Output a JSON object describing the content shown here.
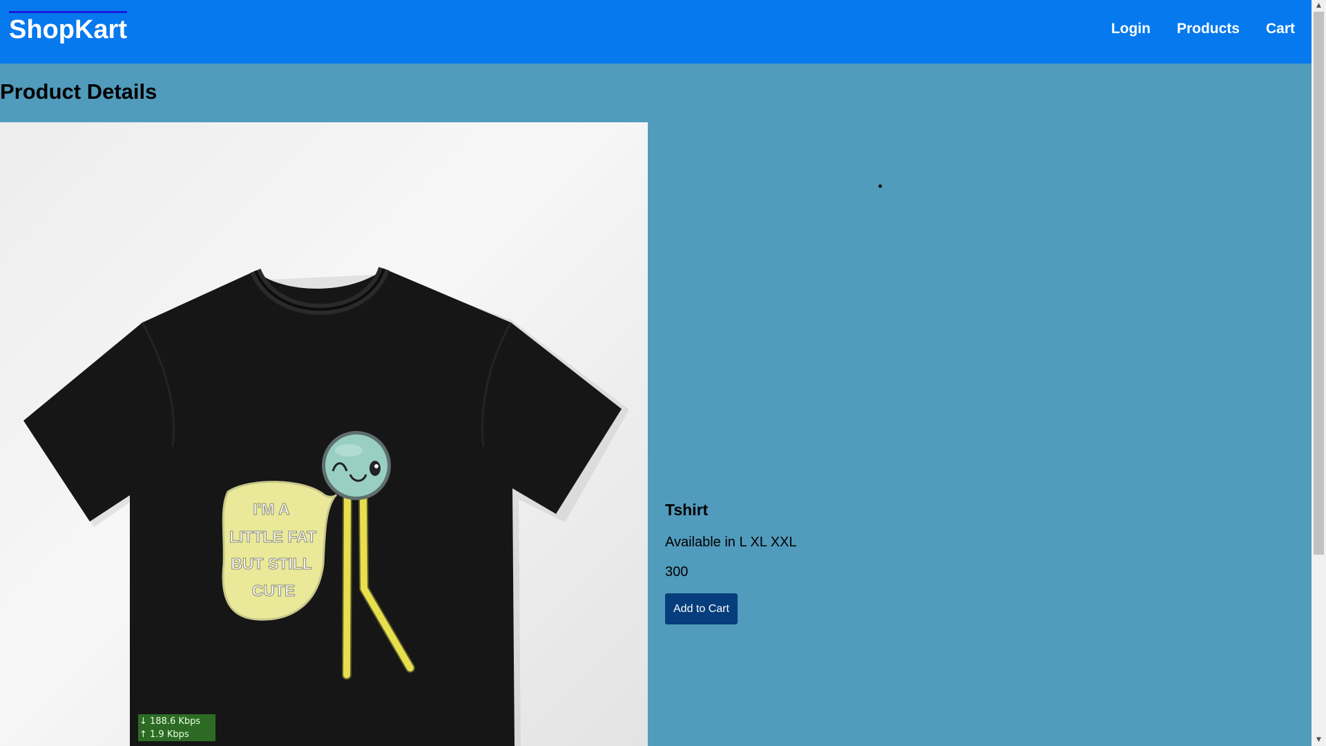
{
  "navbar": {
    "brand": "ShopKart",
    "links": [
      "Login",
      "Products",
      "Cart"
    ]
  },
  "page": {
    "title": "Product Details"
  },
  "product": {
    "image_text_lines": [
      "I'M A",
      "LITTLE FAT",
      "BUT STILL",
      "CUTE"
    ],
    "name": "Tshirt",
    "availability": "Available in L XL XXL",
    "price": "300",
    "add_to_cart_label": "Add to Cart"
  },
  "overlay": {
    "download_speed": "↓ 188.6 Kbps",
    "upload_speed": "↑ 1.9 Kbps"
  },
  "colors": {
    "navbar": "#0679ee",
    "page_background": "#519bbc",
    "button": "#063d7c"
  },
  "icons": {
    "scroll_up": "triangle-up",
    "scroll_down": "triangle-down"
  }
}
